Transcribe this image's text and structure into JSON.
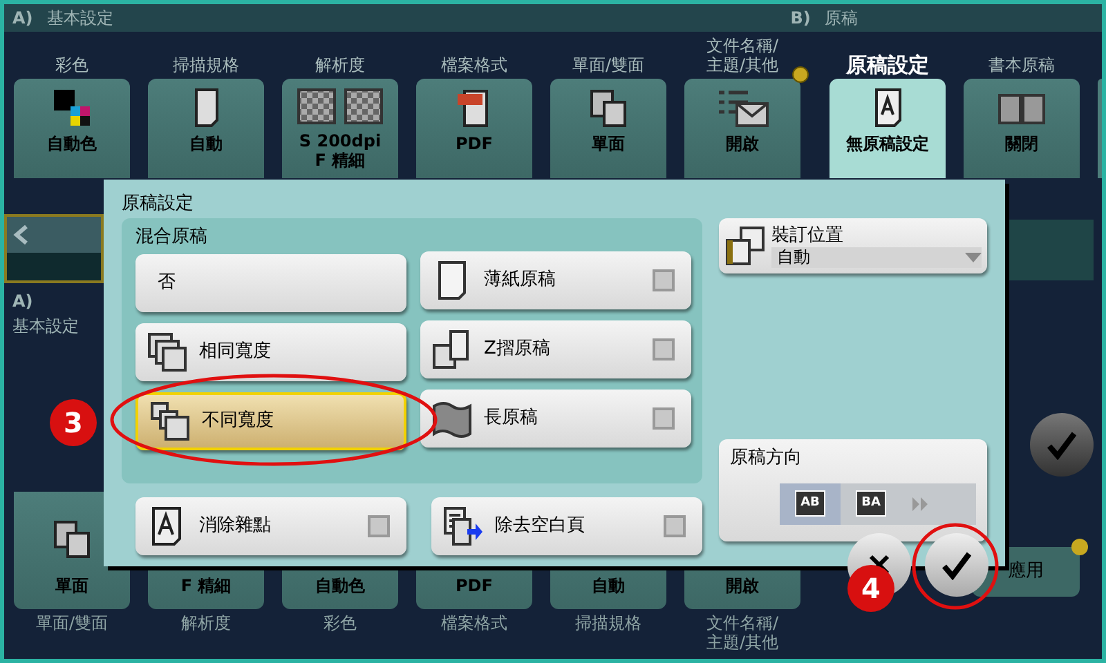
{
  "header": {
    "section_a": "A)",
    "section_a_title": "基本設定",
    "section_b": "B)",
    "section_b_title": "原稿"
  },
  "top_tiles": [
    {
      "group": [
        "彩色"
      ],
      "label": [
        "自動色"
      ],
      "kind": "color",
      "selected": false,
      "dot": false
    },
    {
      "group": [
        "掃描規格"
      ],
      "label": [
        "自動"
      ],
      "kind": "page",
      "selected": false,
      "dot": false
    },
    {
      "group": [
        "解析度"
      ],
      "label": [
        "S 200dpi",
        "F 精細"
      ],
      "kind": "resolution",
      "selected": false,
      "dot": false
    },
    {
      "group": [
        "檔案格式"
      ],
      "label": [
        "PDF"
      ],
      "kind": "pdf",
      "selected": false,
      "dot": false
    },
    {
      "group": [
        "單面/雙面"
      ],
      "label": [
        "單面"
      ],
      "kind": "duplex",
      "selected": false,
      "dot": false
    },
    {
      "group": [
        "文件名稱/",
        "主題/其他"
      ],
      "label": [
        "開啟"
      ],
      "kind": "mail",
      "selected": false,
      "dot": true
    },
    {
      "group": [
        "原稿設定"
      ],
      "label": [
        "無原稿設定"
      ],
      "kind": "original",
      "selected": true,
      "dot": false
    },
    {
      "group": [
        "書本原稿"
      ],
      "label": [
        "關閉"
      ],
      "kind": "book",
      "selected": false,
      "dot": false
    }
  ],
  "side_panel": {
    "section": "A)",
    "title": "基本設定"
  },
  "bottom_tiles": [
    {
      "group": [
        "單面/雙面"
      ],
      "label": "單面",
      "kind": "duplex"
    },
    {
      "group": [
        "解析度"
      ],
      "label": "F 精細",
      "kind": "plain"
    },
    {
      "group": [
        "彩色"
      ],
      "label": "自動色",
      "kind": "plain"
    },
    {
      "group": [
        "檔案格式"
      ],
      "label": "PDF",
      "kind": "plain"
    },
    {
      "group": [
        "掃描規格"
      ],
      "label": "自動",
      "kind": "plain"
    },
    {
      "group": [
        "文件名稱/",
        "主題/其他"
      ],
      "label": "開啟",
      "kind": "plain"
    }
  ],
  "apply_button": {
    "label": "應用",
    "dot": true
  },
  "dialog": {
    "title": "原稿設定",
    "mixed": {
      "title": "混合原稿",
      "options": [
        {
          "label": "否",
          "kind": "none",
          "selected": false
        },
        {
          "label": "相同寬度",
          "kind": "same",
          "selected": false
        },
        {
          "label": "不同寬度",
          "kind": "different",
          "selected": true
        }
      ]
    },
    "checks": [
      {
        "label": "薄紙原稿",
        "kind": "thin",
        "checked": false
      },
      {
        "label": "Z摺原稿",
        "kind": "zfold",
        "checked": false
      },
      {
        "label": "長原稿",
        "kind": "long",
        "checked": false
      }
    ],
    "binding": {
      "label": "裝訂位置",
      "value": "自動"
    },
    "orientation": {
      "title": "原稿方向",
      "options": [
        {
          "label": "AB",
          "selected": true
        },
        {
          "label": "BA",
          "selected": false
        }
      ]
    },
    "bottom_checks": [
      {
        "label": "消除雜點",
        "kind": "noise",
        "checked": false
      },
      {
        "label": "除去空白頁",
        "kind": "blank",
        "checked": false
      }
    ]
  },
  "callouts": [
    {
      "label": "3"
    },
    {
      "label": "4"
    }
  ]
}
